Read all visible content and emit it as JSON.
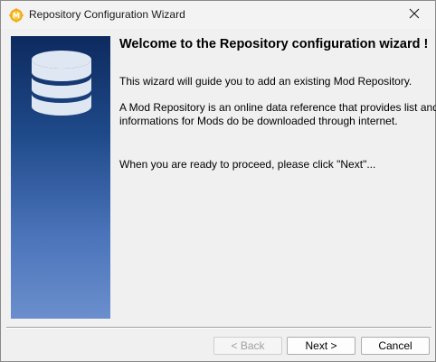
{
  "window": {
    "title": "Repository Configuration Wizard"
  },
  "content": {
    "heading": "Welcome to the Repository configuration wizard !",
    "paragraph1": "This wizard will guide you to add an existing Mod Repository.",
    "paragraph2_line1": "A Mod Repository is an online data reference that provides list and",
    "paragraph2_line2": "informations for Mods do be downloaded through internet.",
    "paragraph3": "When you are ready to proceed, please click \"Next\"..."
  },
  "buttons": {
    "back": "< Back",
    "next": "Next >",
    "cancel": "Cancel"
  },
  "colors": {
    "panel_top": "#0d2a5f",
    "panel_bottom": "#6b8fcd",
    "app_icon": "#f2a818"
  },
  "icons": {
    "app": "gear-icon",
    "panel": "database-icon",
    "close": "close-icon"
  }
}
